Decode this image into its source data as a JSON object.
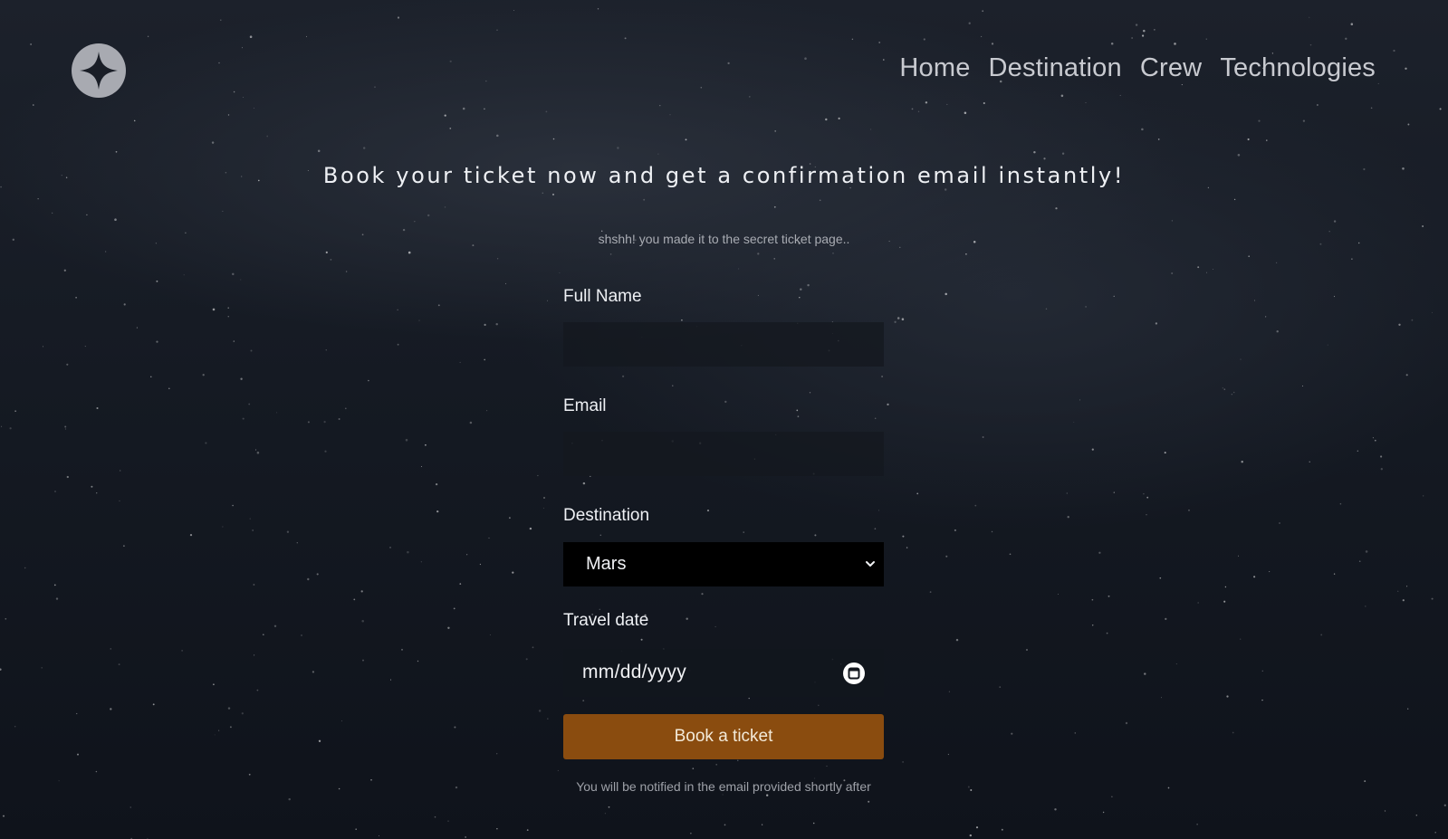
{
  "nav": {
    "items": [
      "Home",
      "Destination",
      "Crew",
      "Technologies"
    ]
  },
  "logo": {
    "icon": "four-point-star-icon"
  },
  "hero": {
    "headline": "Book your ticket now and get a confirmation email instantly!",
    "subtext": "shshh! you made it to the secret ticket page.."
  },
  "form": {
    "full_name": {
      "label": "Full Name",
      "value": "",
      "placeholder": ""
    },
    "email": {
      "label": "Email",
      "value": "",
      "placeholder": ""
    },
    "destination": {
      "label": "Destination",
      "selected": "Mars"
    },
    "travel_date": {
      "label": "Travel date",
      "value": "mm/dd/yyyy"
    },
    "submit_label": "Book a ticket",
    "note": "You will be notified in the email provided shortly after"
  },
  "colors": {
    "accent": "#8a4c0f",
    "background": "#151a23",
    "text": "#e9eaee"
  }
}
